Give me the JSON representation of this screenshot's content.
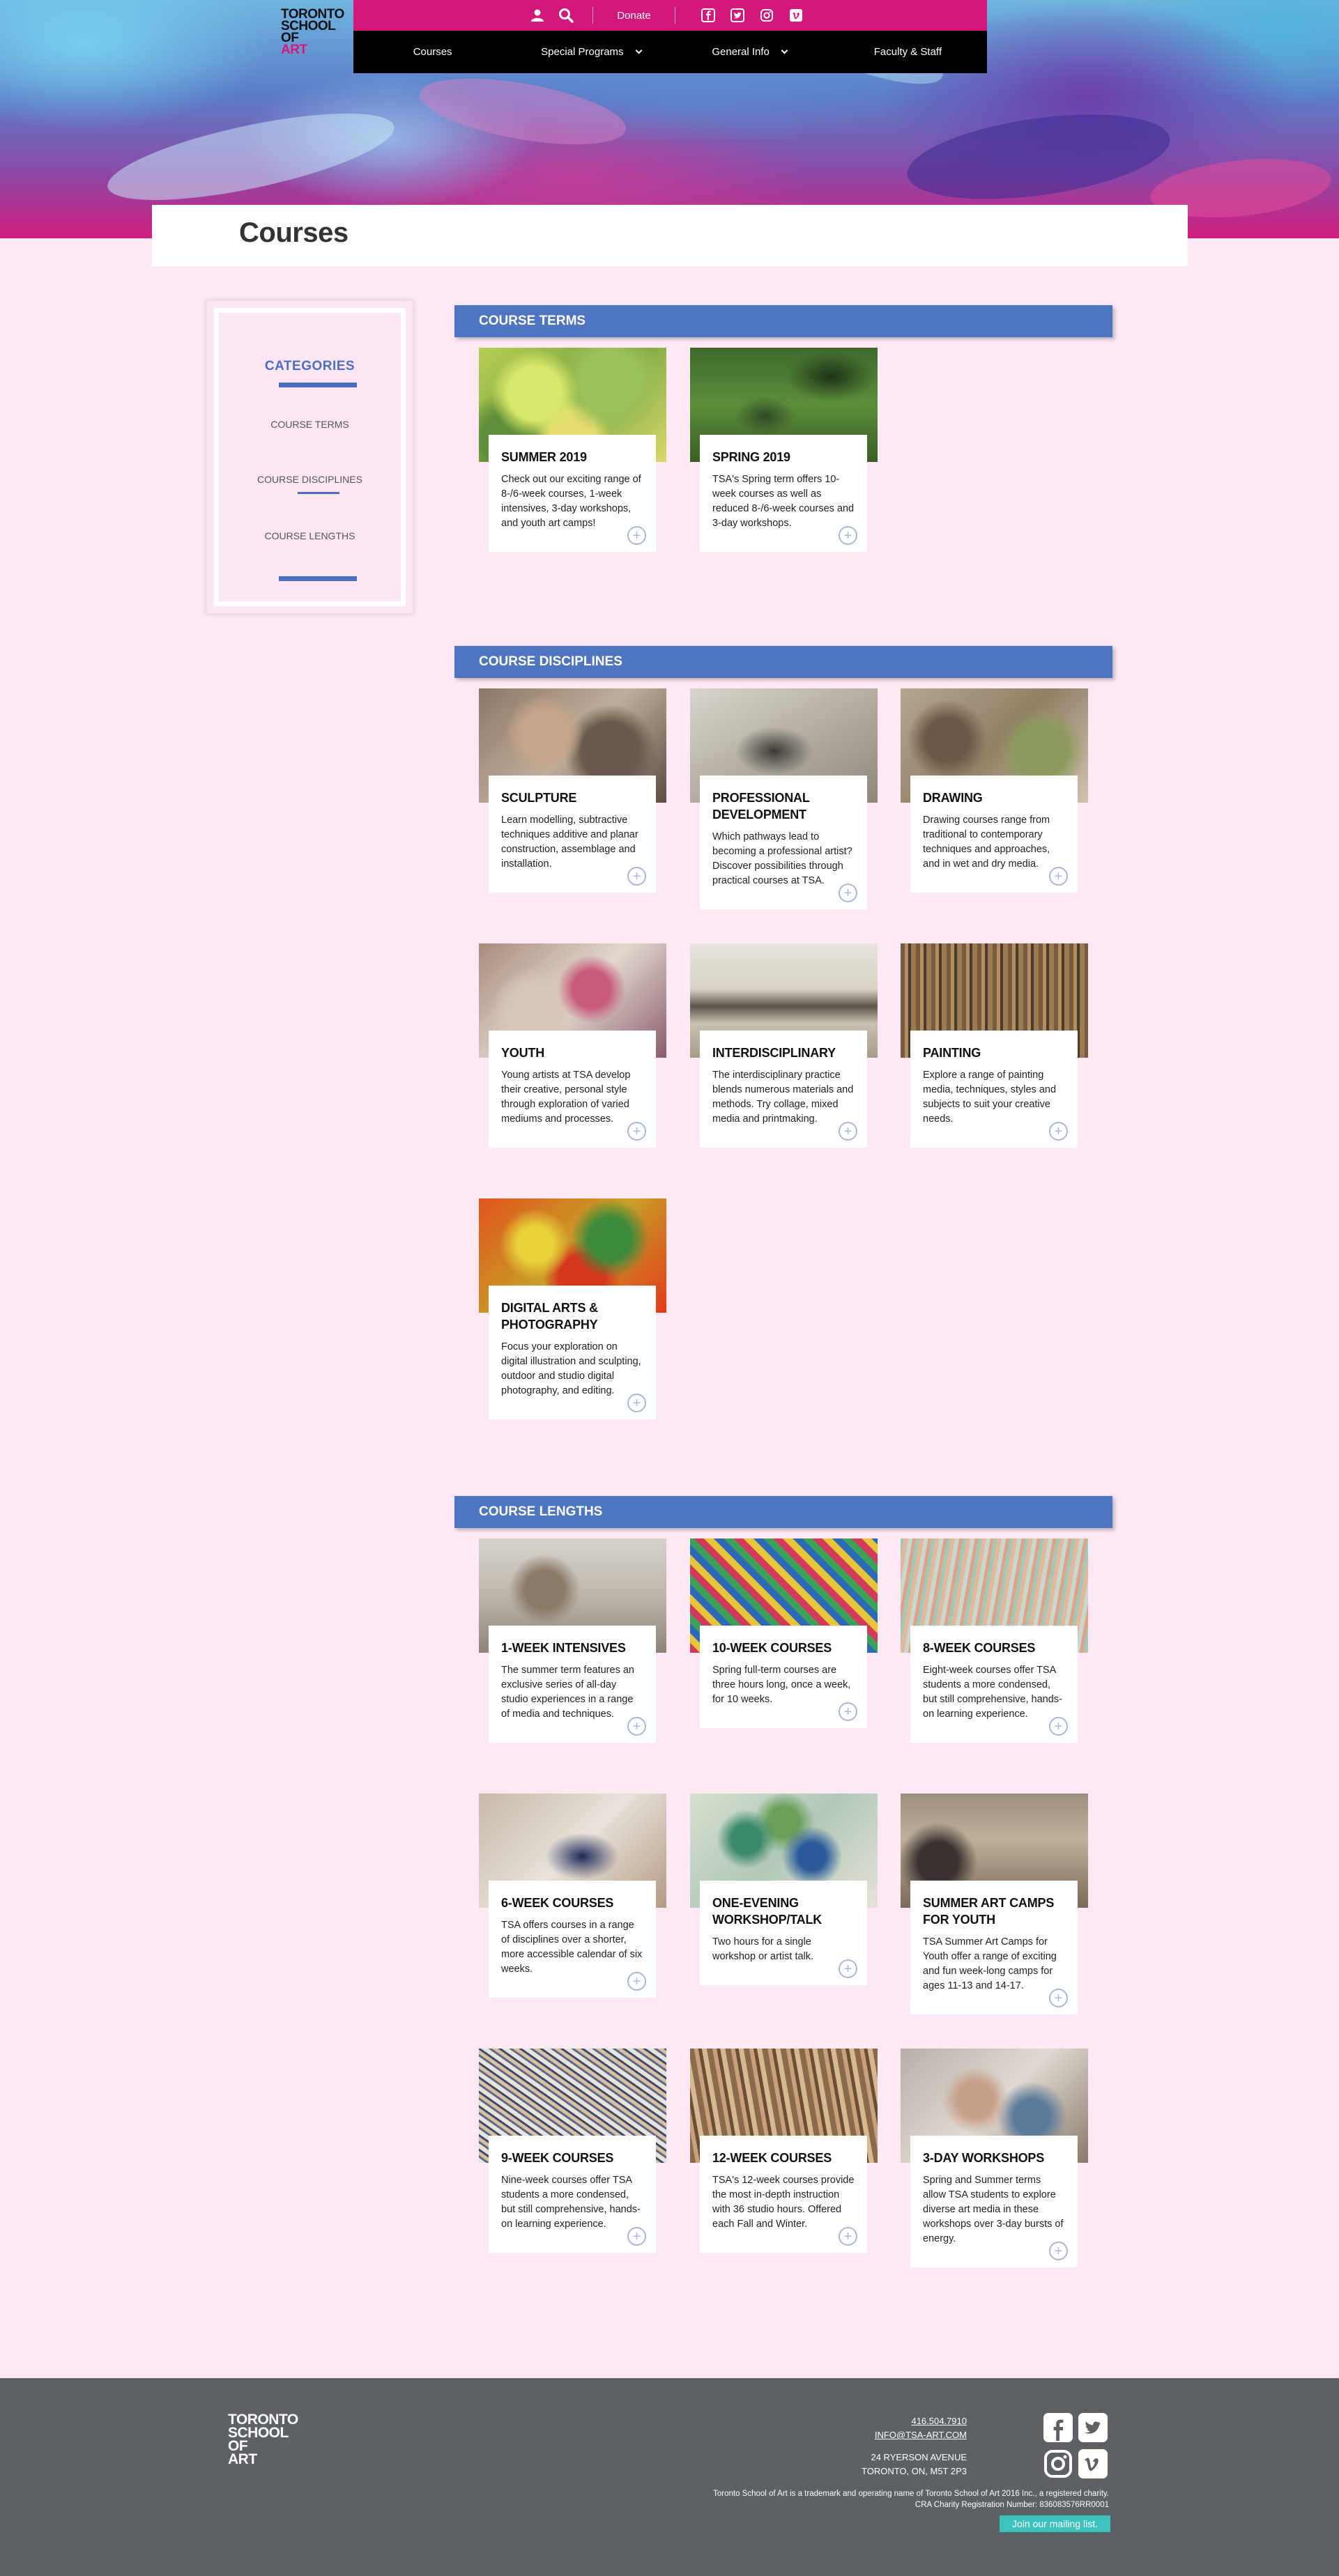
{
  "header": {
    "logo_lines": [
      "TORONTO",
      "SCHOOL",
      "OF",
      "ART"
    ],
    "donate_label": "Donate",
    "nav": [
      {
        "label": "Courses",
        "has_dropdown": false
      },
      {
        "label": "Special Programs",
        "has_dropdown": true
      },
      {
        "label": "General Info",
        "has_dropdown": true
      },
      {
        "label": "Faculty & Staff",
        "has_dropdown": false
      }
    ],
    "icons": [
      "user-icon",
      "search-icon",
      "facebook-icon",
      "twitter-icon",
      "instagram-icon",
      "vimeo-icon"
    ]
  },
  "page": {
    "title": "Courses"
  },
  "sidebar": {
    "title": "CATEGORIES",
    "links": [
      "COURSE TERMS",
      "COURSE DISCIPLINES",
      "COURSE LENGTHS"
    ],
    "accent_color": "#4a6fc0"
  },
  "sections": [
    {
      "header": "COURSE TERMS",
      "cards": [
        {
          "title": "SUMMER 2019",
          "desc": "Check out our exciting range of 8-/6-week courses, 1-week intensives, 3-day workshops, and youth art camps!"
        },
        {
          "title": "SPRING 2019",
          "desc": "TSA's Spring term offers 10-week courses as well as reduced 8-/6-week courses and 3-day workshops."
        }
      ]
    },
    {
      "header": "COURSE DISCIPLINES",
      "cards": [
        {
          "title": "SCULPTURE",
          "desc": "Learn modelling, subtractive techniques additive and planar construction, assemblage and installation."
        },
        {
          "title": "PROFESSIONAL DEVELOPMENT",
          "desc": "Which pathways lead to becoming a professional artist? Discover possibilities through practical courses at TSA."
        },
        {
          "title": "DRAWING",
          "desc": "Drawing courses range from traditional to contemporary techniques and approaches, and in wet and dry media."
        },
        {
          "title": "YOUTH",
          "desc": "Young artists at TSA develop their creative, personal style through exploration of varied mediums and processes."
        },
        {
          "title": "INTERDISCIPLINARY",
          "desc": "The interdisciplinary practice blends numerous materials and methods. Try collage, mixed media and printmaking."
        },
        {
          "title": "PAINTING",
          "desc": "Explore a range of painting media, techniques, styles and subjects to suit your creative needs."
        },
        {
          "title": "DIGITAL ARTS & PHOTOGRAPHY",
          "desc": "Focus your exploration on digital illustration and sculpting, outdoor and studio digital photography, and editing."
        }
      ]
    },
    {
      "header": "COURSE LENGTHS",
      "cards": [
        {
          "title": "1-WEEK INTENSIVES",
          "desc": "The summer term features an exclusive series of all-day studio experiences in a range of media and techniques."
        },
        {
          "title": "10-WEEK COURSES",
          "desc": "Spring full-term courses are three hours long, once a week, for 10 weeks."
        },
        {
          "title": "8-WEEK COURSES",
          "desc": "Eight-week courses offer TSA students a more condensed, but still comprehensive, hands-on learning experience."
        },
        {
          "title": "6-WEEK COURSES",
          "desc": "TSA offers courses in a range of disciplines over a shorter, more accessible calendar of six weeks."
        },
        {
          "title": "ONE-EVENING WORKSHOP/TALK",
          "desc": "Two hours for a single workshop or artist talk."
        },
        {
          "title": "SUMMER ART CAMPS FOR YOUTH",
          "desc": "TSA Summer Art Camps for Youth offer a range of exciting and fun week-long camps for ages 11-13 and 14-17."
        },
        {
          "title": "9-WEEK COURSES",
          "desc": "Nine-week courses offer TSA students a more condensed, but still comprehensive, hands-on learning experience."
        },
        {
          "title": "12-WEEK COURSES",
          "desc": "TSA's 12-week courses provide the most in-depth instruction with 36 studio hours. Offered each Fall and Winter."
        },
        {
          "title": "3-DAY WORKSHOPS",
          "desc": "Spring and Summer terms allow TSA students to explore diverse art media in these workshops over 3-day bursts of energy."
        }
      ]
    }
  ],
  "footer": {
    "logo_lines": [
      "TORONTO",
      "SCHOOL",
      "OF",
      "ART"
    ],
    "phone": "416.504.7910",
    "email": "INFO@TSA-ART.COM",
    "address1": "24 RYERSON AVENUE",
    "address2": "TORONTO, ON, M5T 2P3",
    "legal1": "Toronto School of Art is a trademark and operating name of Toronto School of Art 2016 Inc., a registered charity.",
    "legal2": "CRA Charity Registration Number: 836083576RR0001",
    "mailing_label": "Join our mailing list."
  },
  "colors": {
    "brand_pink": "#d4177b",
    "section_blue": "#4f75c1",
    "page_background": "#fde8f6",
    "footer_gray": "#5d6065",
    "mailing_teal": "#3cc3c0"
  }
}
